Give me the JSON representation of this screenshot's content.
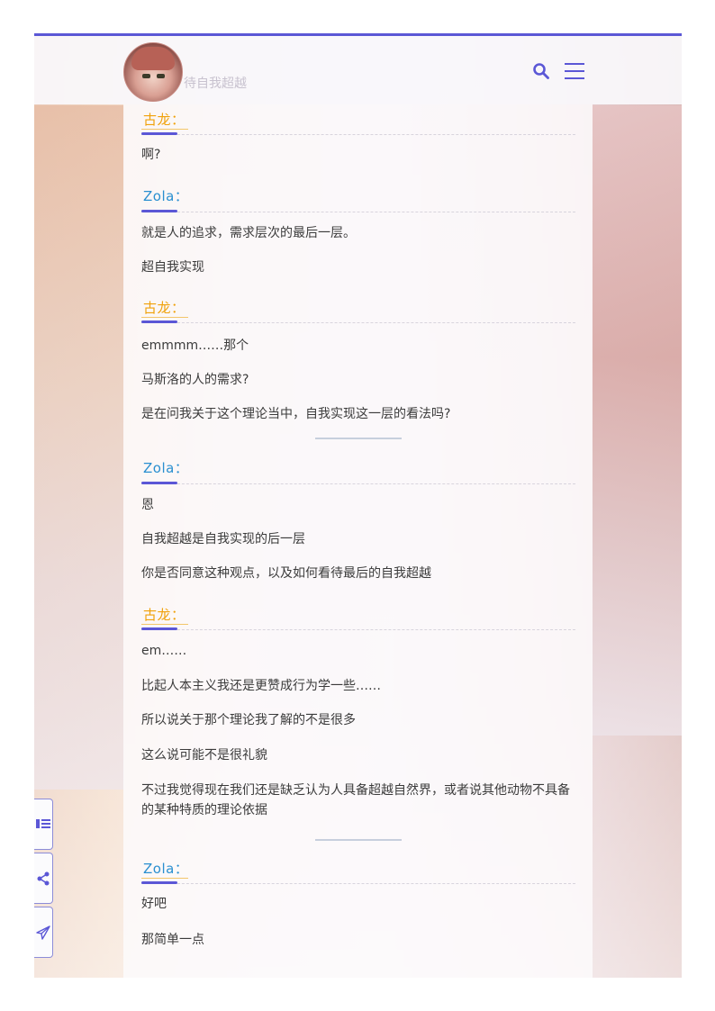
{
  "header": {
    "title": "待自我超越",
    "avatar_alt": "avatar",
    "search_icon": "search-icon",
    "menu_icon": "hamburger-menu-icon",
    "accent_color": "#5b57d6"
  },
  "speakers": {
    "gulong": "古龙：",
    "zola": "Zola："
  },
  "dialogue": [
    {
      "speaker": "古龙：",
      "lines": [
        "啊?"
      ]
    },
    {
      "speaker": "Zola：",
      "lines": [
        "就是人的追求，需求层次的最后一层。",
        "超自我实现"
      ]
    },
    {
      "speaker": "古龙：",
      "lines": [
        "emmmm……那个",
        "马斯洛的人的需求?",
        "是在问我关于这个理论当中，自我实现这一层的看法吗?"
      ]
    },
    {
      "speaker": "Zola：",
      "lines": [
        "恩",
        "自我超越是自我实现的后一层",
        "你是否同意这种观点，以及如何看待最后的自我超越"
      ]
    },
    {
      "speaker": "古龙：",
      "lines": [
        "em……",
        "比起人本主义我还是更赞成行为学一些……",
        "所以说关于那个理论我了解的不是很多",
        "这么说可能不是很礼貌",
        "不过我觉得现在我们还是缺乏认为人具备超越自然界，或者说其他动物不具备的某种特质的理论依据"
      ]
    },
    {
      "speaker": "Zola：",
      "lines": [
        "好吧",
        "那简单一点"
      ]
    }
  ],
  "side_buttons": [
    "toc-icon",
    "share-icon",
    "send-icon"
  ],
  "colors": {
    "gulong": "#f0a10a",
    "zola": "#2a8fd0",
    "text": "#3b3b3b"
  }
}
